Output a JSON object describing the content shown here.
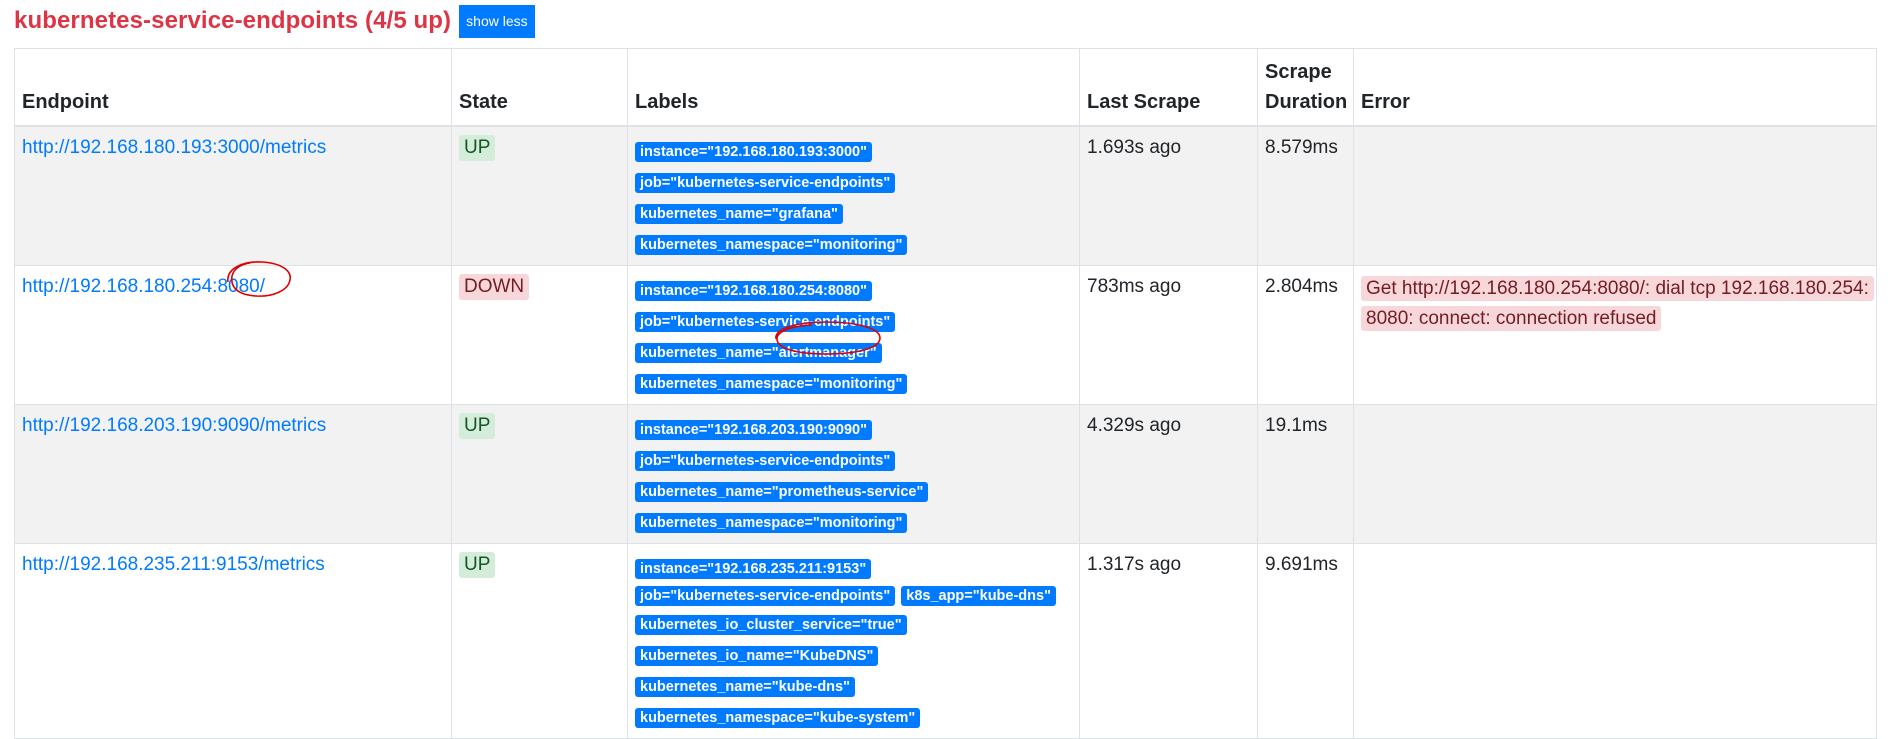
{
  "header": {
    "title": "kubernetes-service-endpoints (4/5 up)",
    "show_less_label": "show less"
  },
  "columns": {
    "endpoint": "Endpoint",
    "state": "State",
    "labels": "Labels",
    "last_scrape": "Last Scrape",
    "scrape_duration": "Scrape Duration",
    "error": "Error"
  },
  "rows": [
    {
      "endpoint": "http://192.168.180.193:3000/metrics",
      "state": "UP",
      "labels": [
        "instance=\"192.168.180.193:3000\"",
        "job=\"kubernetes-service-endpoints\"",
        "kubernetes_name=\"grafana\"",
        "kubernetes_namespace=\"monitoring\""
      ],
      "last_scrape": "1.693s ago",
      "scrape_duration": "8.579ms",
      "error": ""
    },
    {
      "endpoint": "http://192.168.180.254:8080/",
      "state": "DOWN",
      "labels": [
        "instance=\"192.168.180.254:8080\"",
        "job=\"kubernetes-service-endpoints\"",
        "kubernetes_name=\"alertmanager\"",
        "kubernetes_namespace=\"monitoring\""
      ],
      "last_scrape": "783ms ago",
      "scrape_duration": "2.804ms",
      "error": "Get http://192.168.180.254:8080/: dial tcp 192.168.180.254:8080: connect: connection refused"
    },
    {
      "endpoint": "http://192.168.203.190:9090/metrics",
      "state": "UP",
      "labels": [
        "instance=\"192.168.203.190:9090\"",
        "job=\"kubernetes-service-endpoints\"",
        "kubernetes_name=\"prometheus-service\"",
        "kubernetes_namespace=\"monitoring\""
      ],
      "last_scrape": "4.329s ago",
      "scrape_duration": "19.1ms",
      "error": ""
    },
    {
      "endpoint": "http://192.168.235.211:9153/metrics",
      "state": "UP",
      "labels": [
        "instance=\"192.168.235.211:9153\"",
        "job=\"kubernetes-service-endpoints\"",
        "k8s_app=\"kube-dns\"",
        "kubernetes_io_cluster_service=\"true\"",
        "kubernetes_io_name=\"KubeDNS\"",
        "kubernetes_name=\"kube-dns\"",
        "kubernetes_namespace=\"kube-system\""
      ],
      "last_scrape": "1.317s ago",
      "scrape_duration": "9.691ms",
      "error": ""
    }
  ],
  "colors": {
    "title": "#dc3545",
    "link": "#007bff",
    "label_bg": "#007bff",
    "up_bg": "#d4edda",
    "down_bg": "#f8d7da",
    "annotation": "#e00000"
  }
}
